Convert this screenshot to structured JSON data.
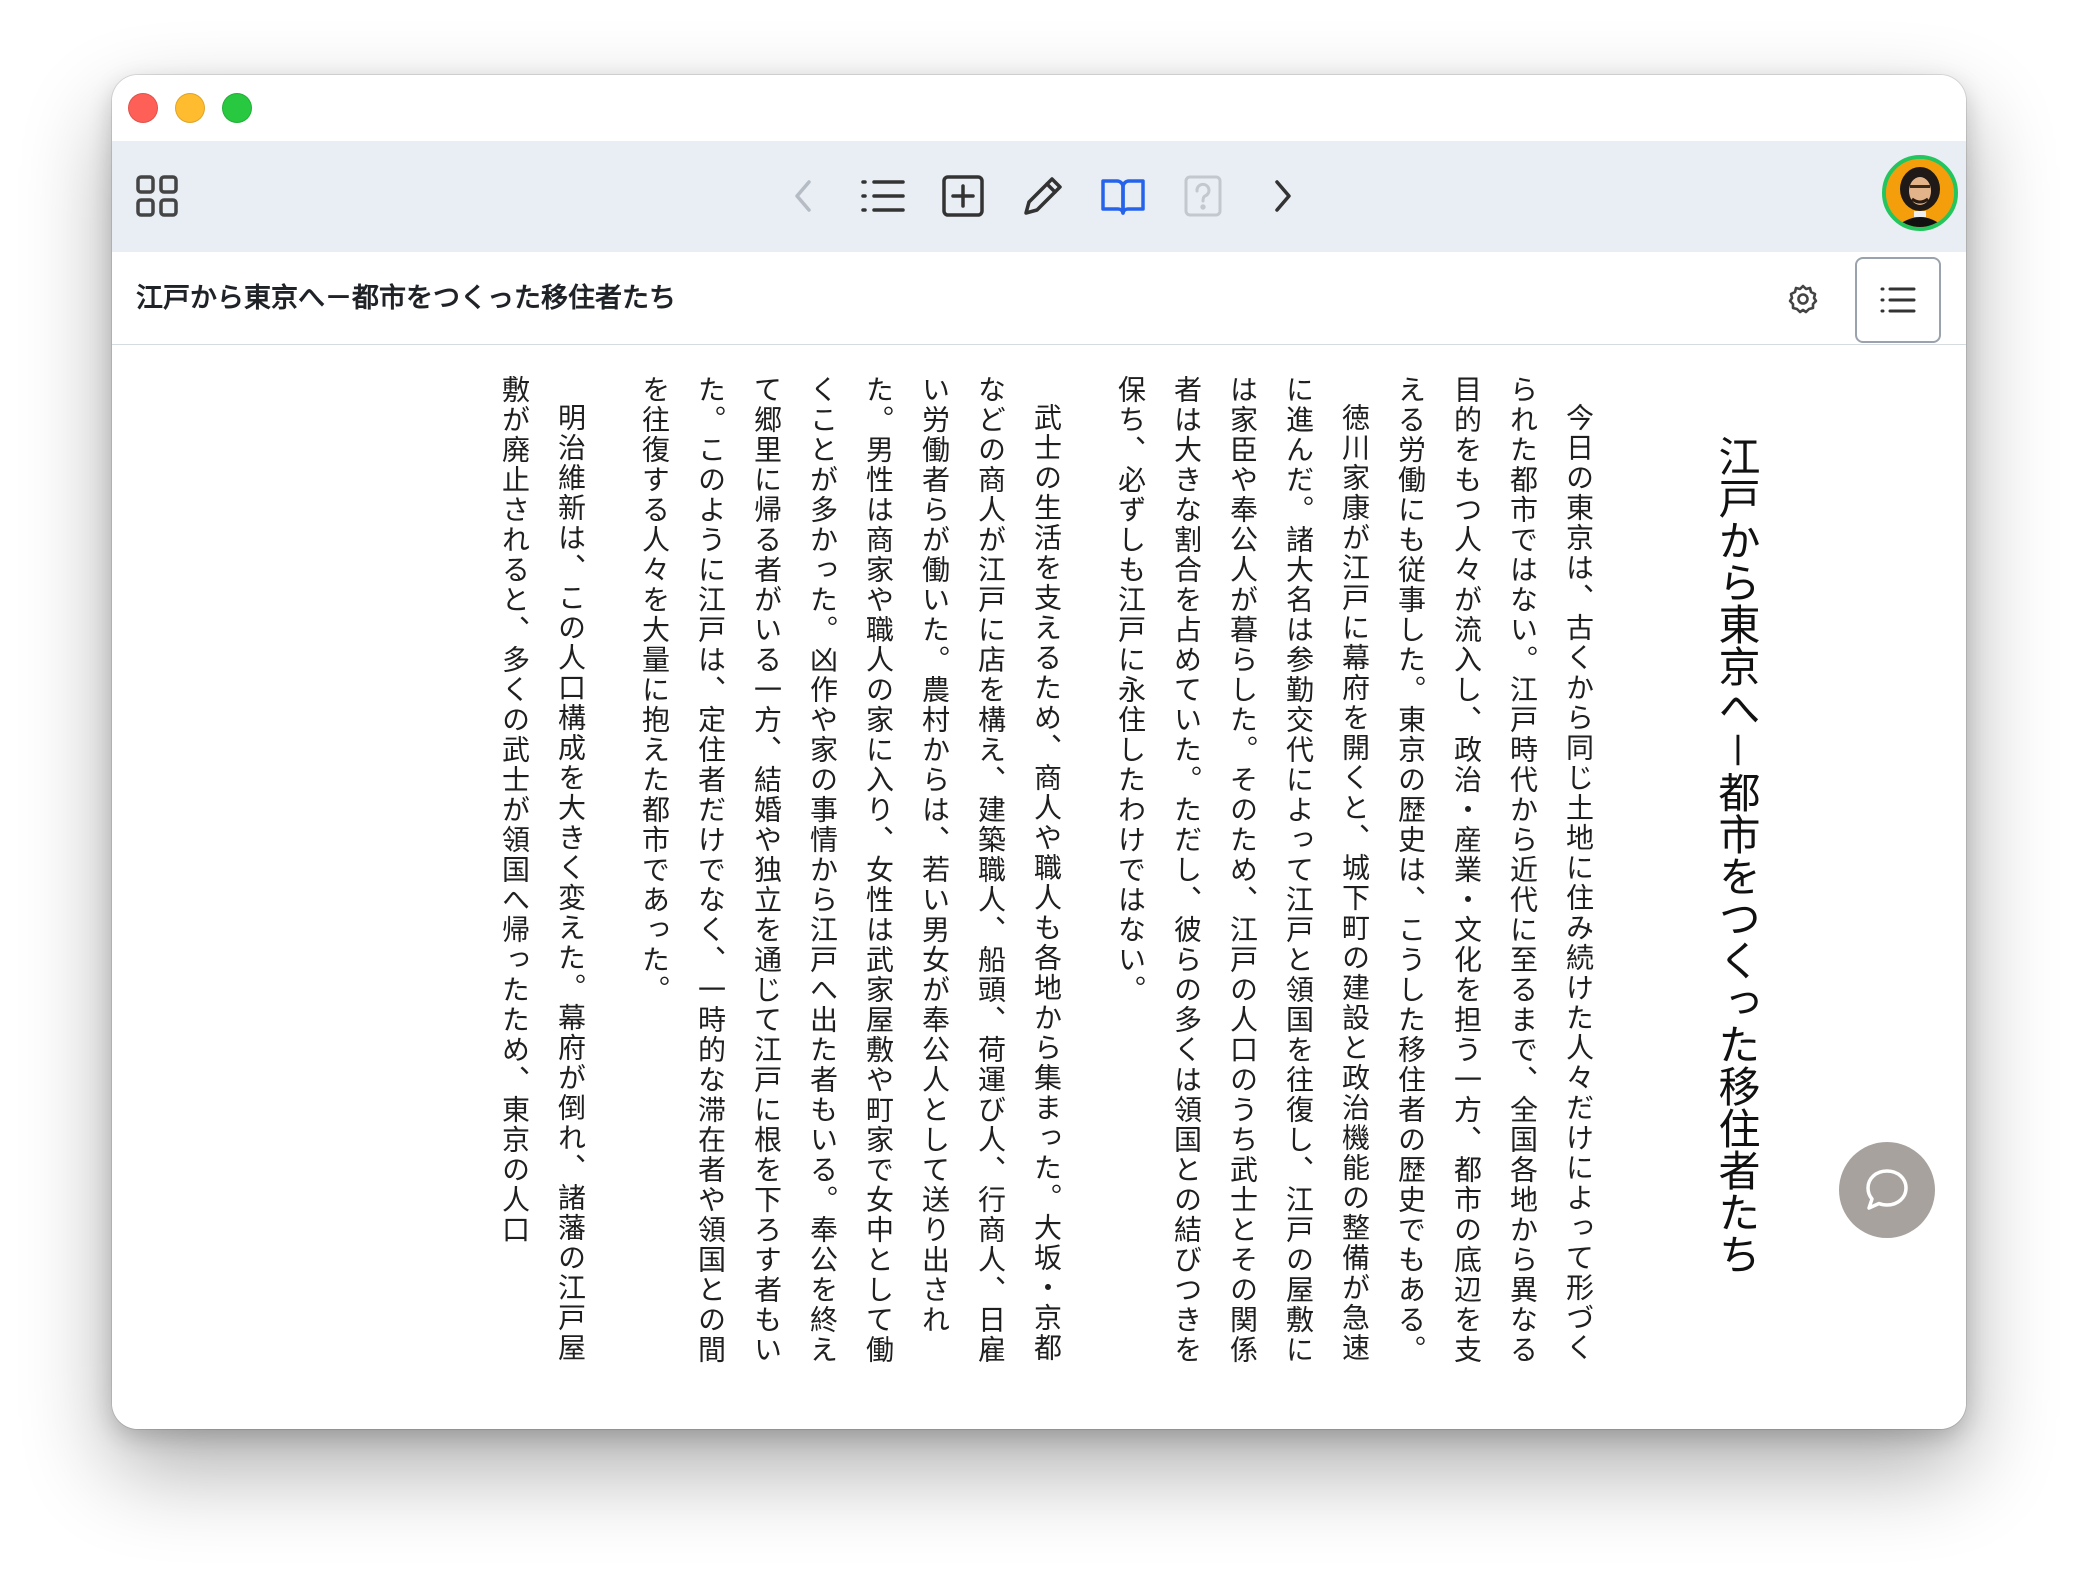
{
  "window": {
    "traffic_lights": [
      "close",
      "minimize",
      "zoom"
    ]
  },
  "toolbar": {
    "icons": [
      "grid-icon",
      "chevron-left-icon",
      "list-icon",
      "plus-square-icon",
      "pencil-icon",
      "book-open-icon",
      "question-square-icon",
      "chevron-right-icon"
    ],
    "accent_color": "#2563eb"
  },
  "document": {
    "title": "江戸から東京へ－都市をつくった移住者たち"
  },
  "article": {
    "title": "江戸から東京へ－都市をつくった移住者たち",
    "paragraphs": [
      "今日の東京は、古くから同じ土地に住み続けた人々だけによって形づくられた都市ではない。江戸時代から近代に至るまで、全国各地から異なる目的をもつ人々が流入し、政治・産業・文化を担う一方、都市の底辺を支える労働にも従事した。東京の歴史は、こうした移住者の歴史でもある。",
      "徳川家康が江戸に幕府を開くと、城下町の建設と政治機能の整備が急速に進んだ。諸大名は参勤交代によって江戸と領国を往復し、江戸の屋敷には家臣や奉公人が暮らした。そのため、江戸の人口のうち武士とその関係者は大きな割合を占めていた。ただし、彼らの多くは領国との結びつきを保ち、必ずしも江戸に永住したわけではない。",
      "武士の生活を支えるため、商人や職人も各地から集まった。大坂・京都などの商人が江戸に店を構え、建築職人、船頭、荷運び人、行商人、日雇い労働者らが働いた。農村からは、若い男女が奉公人として送り出された。男性は商家や職人の家に入り、女性は武家屋敷や町家で女中として働くことが多かった。凶作や家の事情から江戸へ出た者もいる。奉公を終えて郷里に帰る者がいる一方、結婚や独立を通じて江戸に根を下ろす者もいた。このように江戸は、定住者だけでなく、一時的な滞在者や領国との間を往復する人々を大量に抱えた都市であった。",
      "明治維新は、この人口構成を大きく変えた。幕府が倒れ、諸藩の江戸屋敷が廃止されると、多くの武士が領国へ帰ったため、東京の人口"
    ]
  },
  "chat": {
    "icon": "chat-bubble-icon"
  }
}
